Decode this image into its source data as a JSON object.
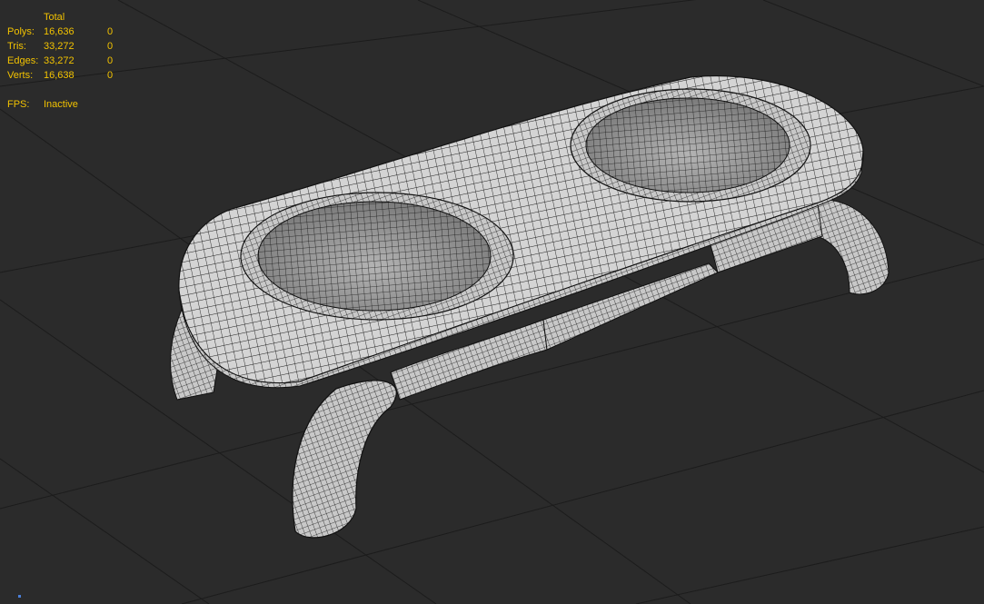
{
  "stats": {
    "header": "Total",
    "rows": [
      {
        "label": "Polys:",
        "total": "16,636",
        "selected": "0"
      },
      {
        "label": "Tris:",
        "total": "33,272",
        "selected": "0"
      },
      {
        "label": "Edges:",
        "total": "33,272",
        "selected": "0"
      },
      {
        "label": "Verts:",
        "total": "16,638",
        "selected": "0"
      }
    ],
    "fps_label": "FPS:",
    "fps_value": "Inactive"
  },
  "colors": {
    "viewport_bg": "#2b2b2b",
    "grid": "#1c1c1c",
    "stats_text": "#f2c200",
    "mesh_fill": "#d6d6d6",
    "wire": "#1a1a1a"
  },
  "viewport": {
    "object": "pet-bowl-stand",
    "display_mode": "shaded-wireframe"
  }
}
